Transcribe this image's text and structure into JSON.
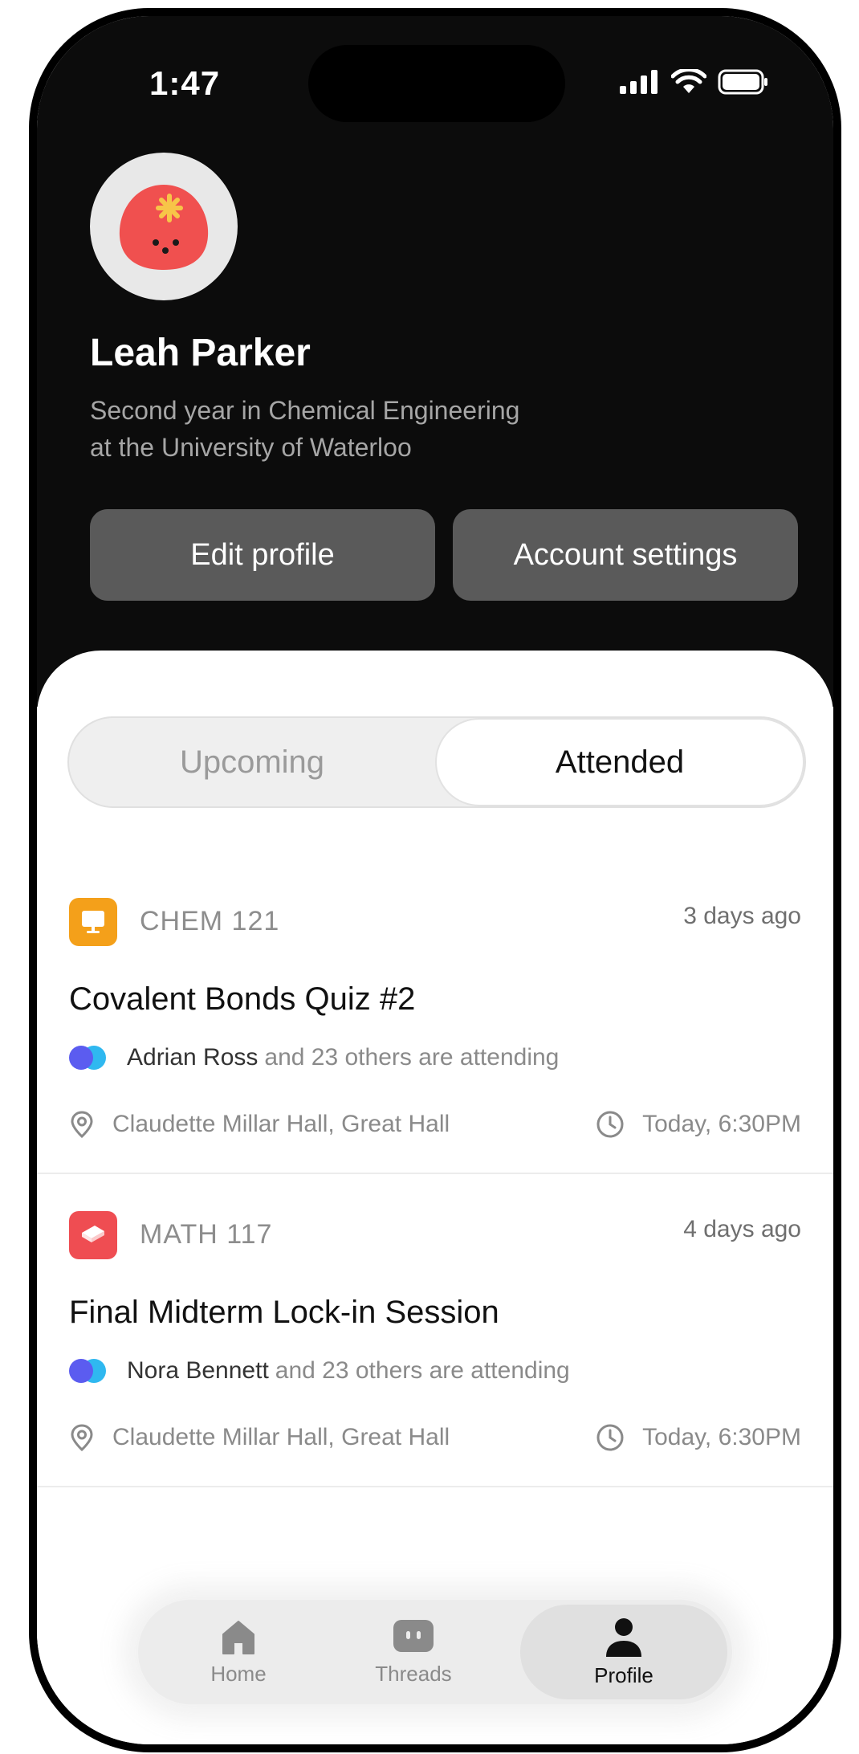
{
  "status_bar": {
    "time": "1:47"
  },
  "profile": {
    "name": "Leah Parker",
    "bio_line1": "Second year in Chemical Engineering",
    "bio_line2": "at the University of Waterloo",
    "avatar_icon": "strawberry-avatar-icon"
  },
  "actions": {
    "edit_label": "Edit profile",
    "settings_label": "Account settings"
  },
  "tabs": {
    "upcoming": "Upcoming",
    "attended": "Attended",
    "selected": "Attended"
  },
  "events": [
    {
      "course": "CHEM 121",
      "course_color": "#f4a01a",
      "course_icon": "presentation-icon",
      "time_ago": "3 days ago",
      "title": "Covalent Bonds Quiz #2",
      "attendee_name": "Adrian Ross",
      "attendee_rest": "and 23 others are attending",
      "location": "Claudette Millar Hall, Great Hall",
      "time": "Today, 6:30PM"
    },
    {
      "course": "MATH 117",
      "course_color": "#ef4d52",
      "course_icon": "book-icon",
      "time_ago": "4 days ago",
      "title": "Final Midterm Lock-in Session",
      "attendee_name": "Nora Bennett",
      "attendee_rest": "and 23 others are attending",
      "location": "Claudette Millar Hall, Great Hall",
      "time": "Today, 6:30PM"
    }
  ],
  "nav": {
    "home": "Home",
    "threads": "Threads",
    "profile": "Profile",
    "active": "Profile"
  },
  "colors": {
    "header_bg": "#0c0c0c",
    "button_bg": "#5a5a5a",
    "avatar_red": "#f0504f",
    "attendee_dot_1": "#5b5cf0",
    "attendee_dot_2": "#2fb8f0"
  }
}
